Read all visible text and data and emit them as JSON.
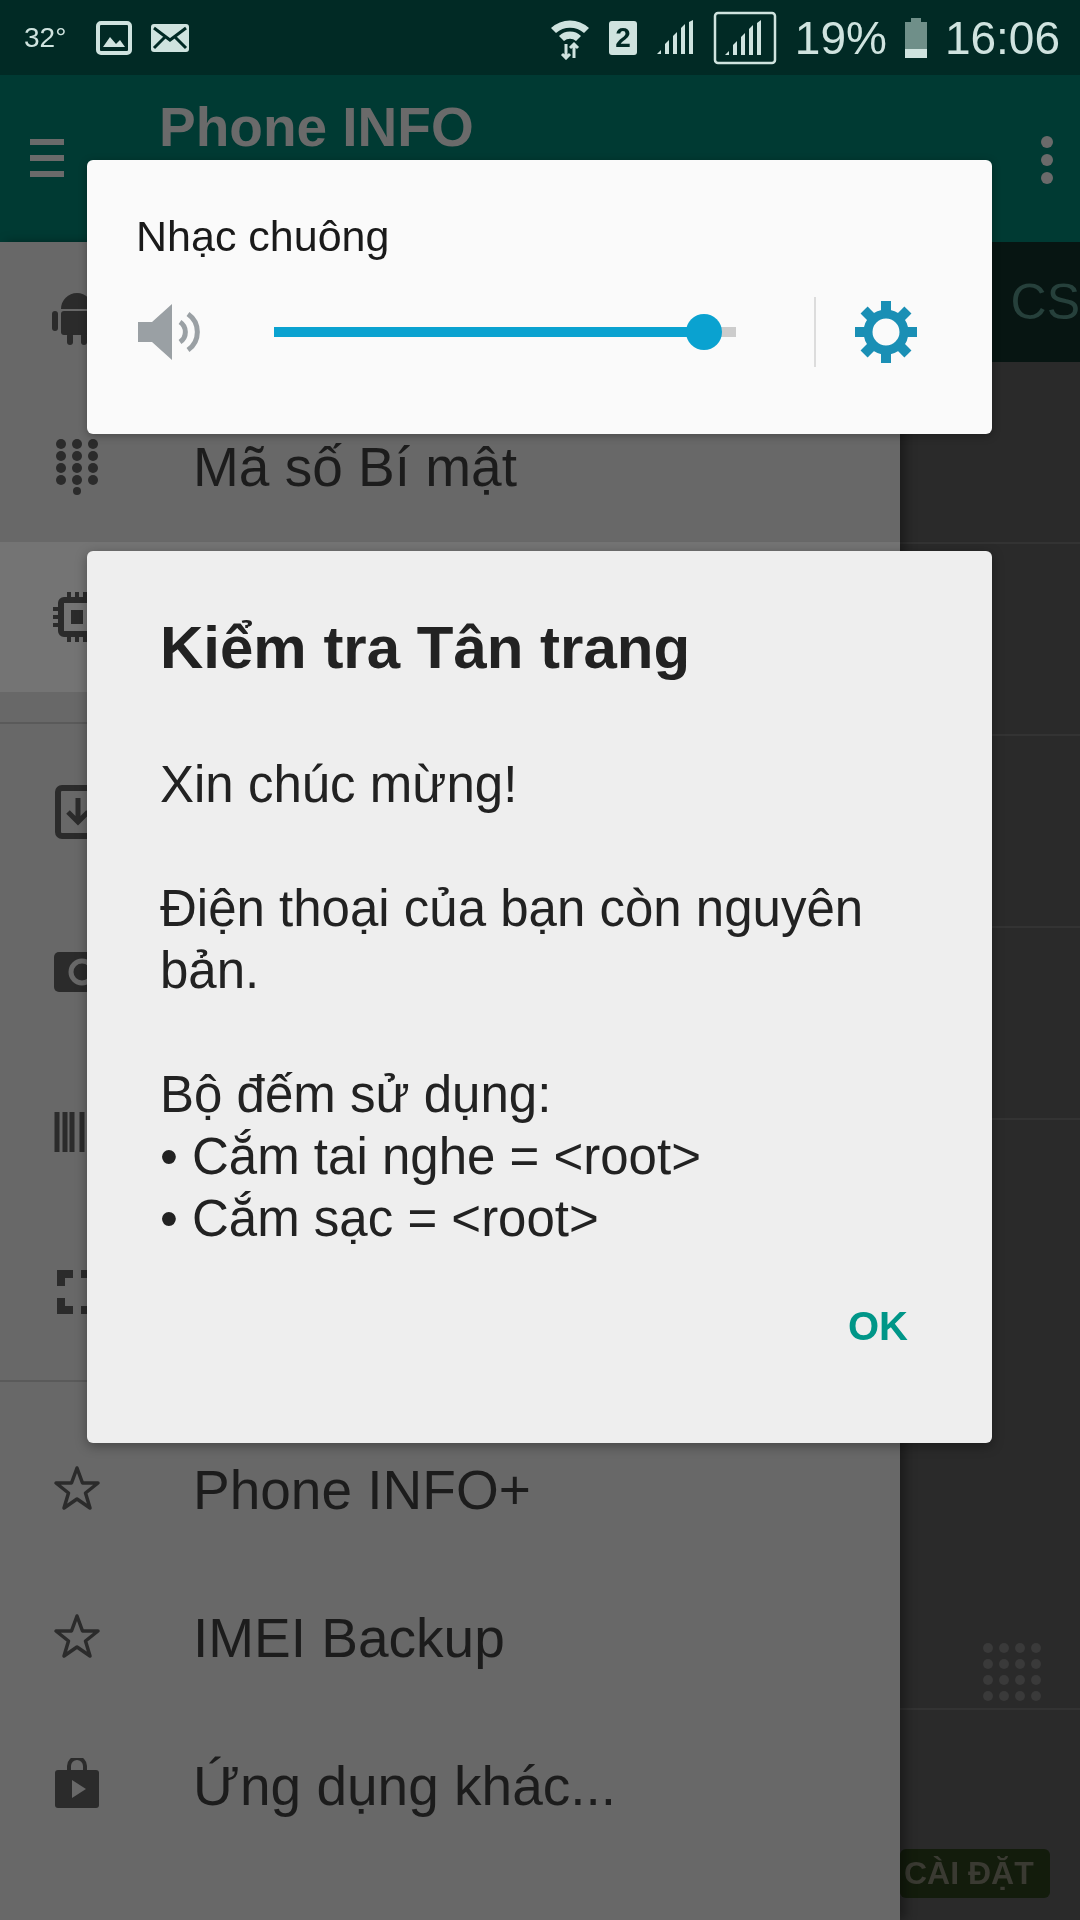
{
  "status_bar": {
    "temperature": "32°",
    "sim_slot": "2",
    "battery": "19%",
    "time": "16:06"
  },
  "app_bar": {
    "title": "Phone INFO"
  },
  "drawer": {
    "groups": [
      [
        {
          "selected": false
        },
        {
          "label": "Mã số Bí mật",
          "selected": false
        },
        {
          "selected": true
        }
      ],
      [
        {
          "selected": false
        },
        {
          "selected": false
        },
        {
          "selected": false
        },
        {
          "selected": false
        }
      ],
      [
        {
          "label": "Phone INFO+",
          "selected": false
        },
        {
          "label": "IMEI Backup",
          "selected": false
        },
        {
          "label": "Ứng dụng khác...",
          "selected": false
        }
      ]
    ]
  },
  "background": {
    "tab": "CS",
    "install_button": "CÀI ĐẶT"
  },
  "volume_panel": {
    "label": "Nhạc chuông",
    "level": 0.93
  },
  "dialog": {
    "title": "Kiểm tra Tân trang",
    "paragraphs": [
      [
        "Xin chúc mừng!"
      ],
      [
        "Điện thoại của bạn còn nguyên bản."
      ],
      [
        "Bộ đếm sử dụng:",
        "• Cắm tai nghe = <root>",
        "• Cắm sạc = <root>"
      ]
    ],
    "button": "OK"
  }
}
